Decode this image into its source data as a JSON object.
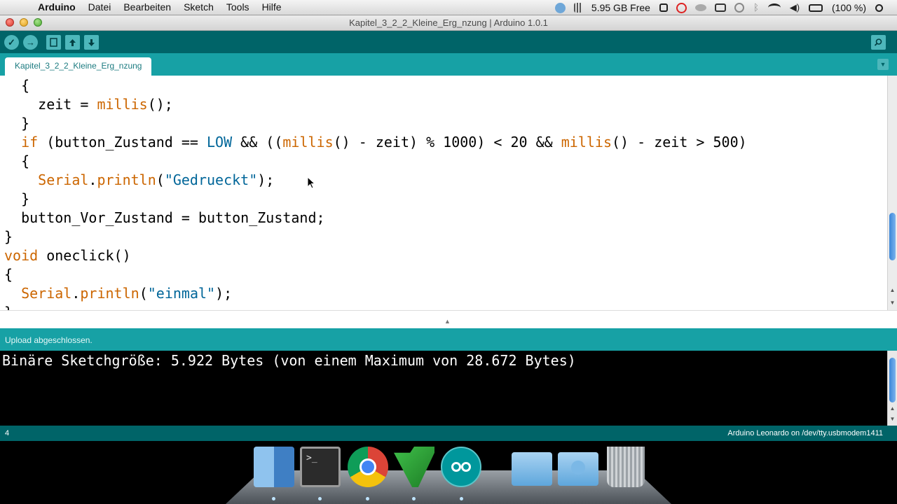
{
  "menubar": {
    "menus": [
      "Arduino",
      "Datei",
      "Bearbeiten",
      "Sketch",
      "Tools",
      "Hilfe"
    ],
    "status": {
      "disk_free": "5.95 GB Free",
      "battery": "(100 %)"
    }
  },
  "window": {
    "title": "Kapitel_3_2_2_Kleine_Erg_nzung | Arduino 1.0.1"
  },
  "toolbar": {
    "verify_label": "✓",
    "upload_label": "→"
  },
  "tab": {
    "label": "Kapitel_3_2_2_Kleine_Erg_nzung"
  },
  "editor": {
    "lines": [
      "  {",
      "    zeit = millis();",
      "  }",
      "  if (button_Zustand == LOW && ((millis() - zeit) % 1000) < 20 && millis() - zeit > 500)",
      "  {",
      "    Serial.println(\"Gedrueckt\");",
      "  }",
      "  button_Vor_Zustand = button_Zustand;",
      "}",
      "void oneclick()",
      "{",
      "  Serial.println(\"einmal\");",
      "}"
    ]
  },
  "status": {
    "message": "Upload abgeschlossen."
  },
  "console": {
    "output": "Binäre Sketchgröße: 5.922 Bytes (von einem Maximum von 28.672 Bytes)"
  },
  "footer": {
    "line_number": "4",
    "board": "Arduino Leonardo on /dev/tty.usbmodem1411"
  },
  "dock": {
    "apps": [
      "finder-icon",
      "terminal-icon",
      "chrome-icon",
      "vim-icon",
      "arduino-icon",
      "folder-icon",
      "downloads-folder-icon",
      "trash-icon"
    ]
  }
}
